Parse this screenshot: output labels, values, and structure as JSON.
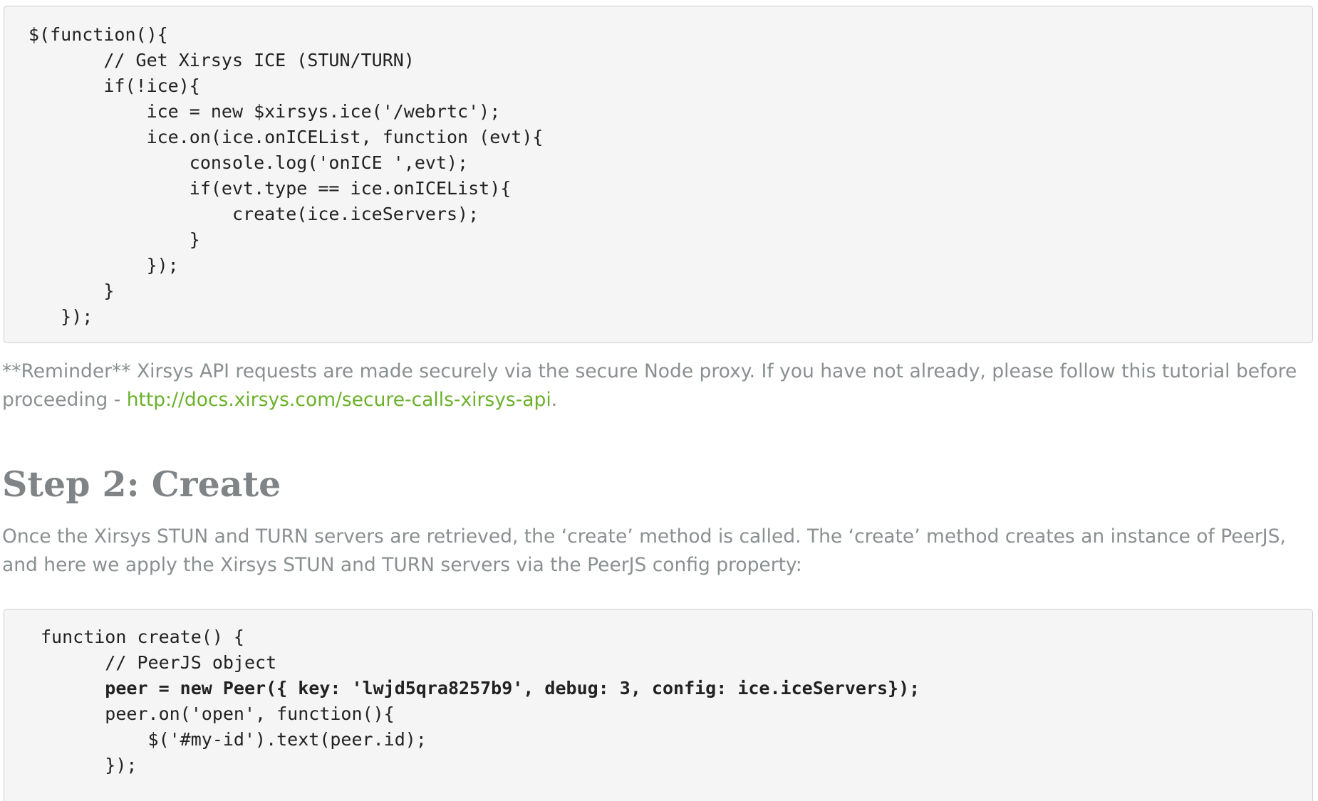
{
  "code_block_1": {
    "lines": [
      "$(function(){",
      "       // Get Xirsys ICE (STUN/TURN)",
      "       if(!ice){",
      "           ice = new $xirsys.ice('/webrtc');",
      "           ice.on(ice.onICEList, function (evt){",
      "               console.log('onICE ',evt);",
      "               if(evt.type == ice.onICEList){",
      "                   create(ice.iceServers);",
      "               }",
      "           });",
      "       }",
      "   });"
    ]
  },
  "reminder": {
    "text": "**Reminder** Xirsys API requests are made securely via the secure Node proxy. If you have not already, please follow this tutorial before proceeding - ",
    "link_text": "http://docs.xirsys.com/secure-calls-xirsys-api",
    "suffix": "."
  },
  "step2": {
    "heading": "Step 2: Create",
    "intro": "Once the Xirsys STUN and TURN servers are retrieved, the ‘create’ method is called. The ‘create’ method creates an instance of PeerJS, and here we apply the Xirsys STUN and TURN servers via the PeerJS config property:"
  },
  "code_block_2": {
    "lines": [
      "function create() {",
      "      // PeerJS object",
      "      peer = new Peer({ key: 'lwjd5qra8257b9', debug: 3, config: ice.iceServers});",
      "      peer.on('open', function(){",
      "          $('#my-id').text(peer.id);",
      "      });"
    ]
  }
}
